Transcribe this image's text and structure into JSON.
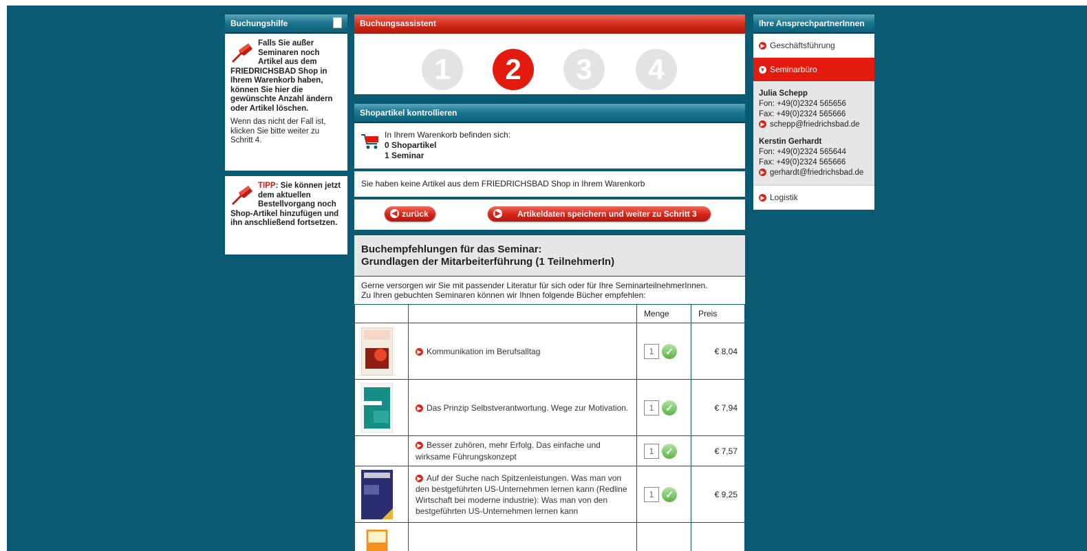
{
  "left": {
    "header": "Buchungshilfe",
    "help1_bold": "Falls Sie außer Seminaren noch Artikel aus dem FRIEDRICHSBAD Shop in Ihrem Warenkorb haben, können Sie hier die gewünschte Anzahl ändern oder Artikel löschen.",
    "help1_text": "Wenn das nicht der Fall ist, klicken Sie bitte weiter zu Schritt 4.",
    "tip_label": "TIPP",
    "tip_text": ": Sie können jetzt dem aktuellen Bestellvorgang noch Shop-Artikel hinzufügen und ihn anschließend fortsetzen."
  },
  "center": {
    "assistant_header": "Buchungsassistent",
    "steps": [
      "1",
      "2",
      "3",
      "4"
    ],
    "active_step": 2,
    "shop_header": "Shopartikel kontrollieren",
    "cart_intro": "In Ihrem Warenkorb befinden sich:",
    "cart_shop": "0 Shopartikel",
    "cart_seminar": "1 Seminar",
    "no_items": "Sie haben keine Artikel aus dem FRIEDRICHSBAD Shop in Ihrem Warenkorb",
    "back_button": "zurück",
    "next_button": "Artikeldaten speichern und weiter zu Schritt 3",
    "reco_title_1": "Buchempfehlungen für das Seminar:",
    "reco_title_2": "Grundlagen der Mitarbeiterführung (1 TeilnehmerIn)",
    "reco_intro_1": "Gerne versorgen wir Sie mit passender Literatur für sich oder für Ihre SeminarteilnehmerInnen.",
    "reco_intro_2": "Zu Ihren gebuchten Seminaren können wir Ihnen folgende Bücher empfehlen:",
    "col_qty": "Menge",
    "col_price": "Preis",
    "books": [
      {
        "title": "Kommunikation im Berufsalltag",
        "qty": "1",
        "price": "€ 8,04"
      },
      {
        "title": "Das Prinzip Selbstverantwortung. Wege zur Motivation.",
        "qty": "1",
        "price": "€ 7,94"
      },
      {
        "title": "Besser zuhören, mehr Erfolg. Das einfache und wirksame Führungskonzept",
        "qty": "1",
        "price": "€ 7,57"
      },
      {
        "title": "Auf der Suche nach Spitzenleistungen. Was man von den bestgeführten US-Unternehmen lernen kann (Redline Wirtschaft bei moderne industrie): Was man von den bestgeführten US-Unternehmen lernen kann",
        "qty": "1",
        "price": "€ 9,25"
      }
    ]
  },
  "right": {
    "header": "Ihre AnsprechpartnerInnen",
    "nav_management": "Geschäftsführung",
    "nav_seminar": "Seminarbüro",
    "nav_logistics": "Logistik",
    "contacts": [
      {
        "name": "Julia Schepp",
        "phone": "Fon: +49(0)2324 565656",
        "fax": "Fax: +49(0)2324 565666",
        "email": "schepp@friedrichsbad.de"
      },
      {
        "name": "Kerstin Gerhardt",
        "phone": "Fon: +49(0)2324 565644",
        "fax": "Fax: +49(0)2324 565666",
        "email": "gerhardt@friedrichsbad.de"
      }
    ]
  },
  "colors": {
    "teal": "#0a5a73",
    "red": "#e31b0e",
    "grey": "#e6e6e6"
  }
}
